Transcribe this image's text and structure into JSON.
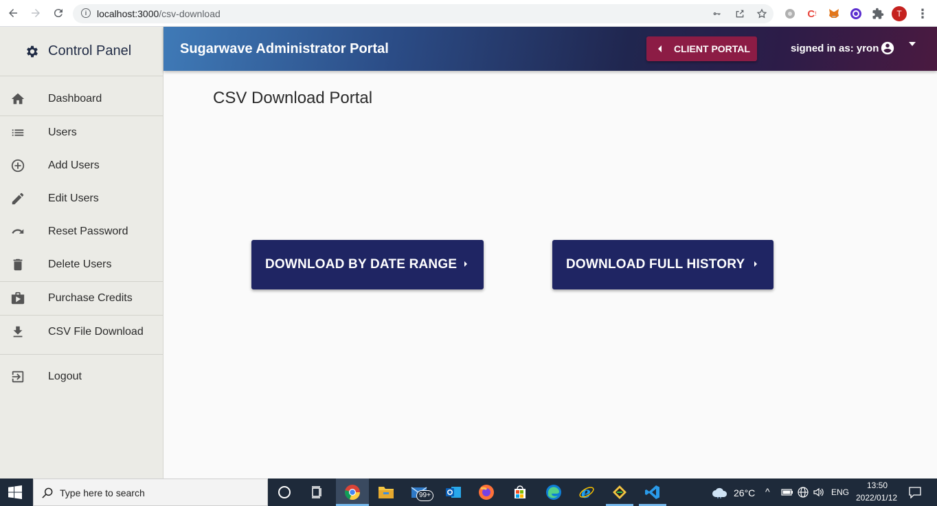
{
  "browser": {
    "url_host": "localhost:3000",
    "url_path": "/csv-download",
    "avatar_letter": "T"
  },
  "sidebar": {
    "title": "Control Panel",
    "items": [
      {
        "label": "Dashboard",
        "icon": "home-icon"
      },
      {
        "label": "Users",
        "icon": "list-icon"
      },
      {
        "label": "Add Users",
        "icon": "add-circle-icon"
      },
      {
        "label": "Edit Users",
        "icon": "pencil-icon"
      },
      {
        "label": "Reset Password",
        "icon": "redo-icon"
      },
      {
        "label": "Delete Users",
        "icon": "trash-icon"
      },
      {
        "label": "Purchase Credits",
        "icon": "shopping-bag-icon"
      },
      {
        "label": "CSV File Download",
        "icon": "download-icon"
      },
      {
        "label": "Logout",
        "icon": "logout-icon"
      }
    ]
  },
  "header": {
    "title": "Sugarwave Administrator Portal",
    "client_portal_label": "CLIENT PORTAL",
    "signed_in_label": "signed in as: yron"
  },
  "main": {
    "page_title": "CSV Download Portal",
    "download_by_date_label": "DOWNLOAD BY DATE RANGE",
    "download_full_label": "DOWNLOAD FULL HISTORY"
  },
  "taskbar": {
    "search_placeholder": "Type here to search",
    "mail_badge": "99+",
    "weather": "26°C",
    "language": "ENG",
    "time": "13:50",
    "date": "2022/01/12"
  },
  "colors": {
    "primary_button": "#1f2563",
    "client_portal_button": "#8c1c45",
    "sidebar_bg": "#ebebe6"
  }
}
